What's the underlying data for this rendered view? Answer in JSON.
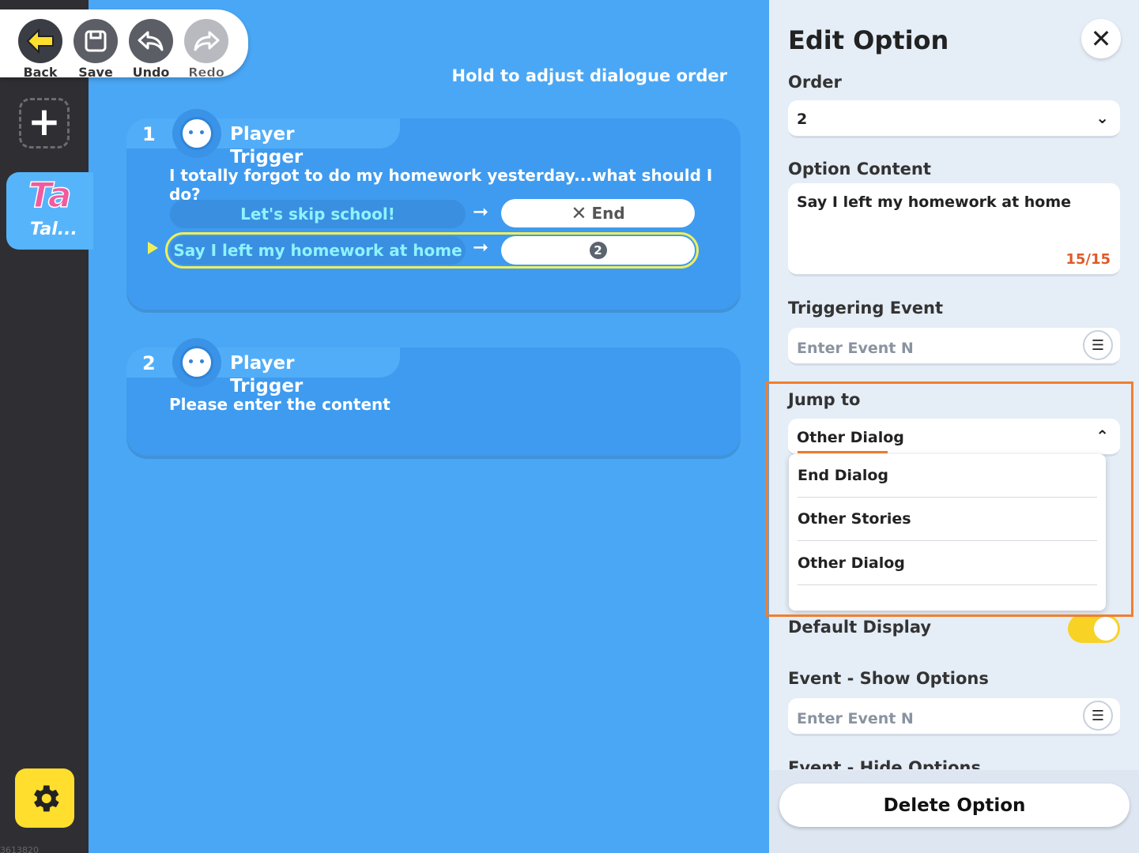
{
  "toolbar": {
    "back_label": "Back",
    "save_label": "Save",
    "undo_label": "Undo",
    "redo_label": "Redo"
  },
  "sidebar": {
    "tab_big": "Ta",
    "tab_small": "Tal...",
    "footer_id": "3613820"
  },
  "hint": "Hold to adjust dialogue order",
  "dialogs": [
    {
      "number": "1",
      "speaker": "Player",
      "trigger": "Trigger",
      "text": "I totally forgot to do my homework yesterday...what should I do?",
      "options": [
        {
          "label": "Let's skip school!",
          "target": "End",
          "target_icon": "x-icon"
        },
        {
          "label": "Say I left my homework at home",
          "target": "2",
          "selected": true
        }
      ]
    },
    {
      "number": "2",
      "speaker": "Player",
      "trigger": "Trigger",
      "text": "Please enter the content"
    }
  ],
  "panel": {
    "title": "Edit Option",
    "order_label": "Order",
    "order_value": "2",
    "content_label": "Option Content",
    "content_value": "Say I left my homework at home",
    "content_counter": "15/15",
    "trigger_label": "Triggering Event",
    "trigger_placeholder": "Enter Event N",
    "jump_label": "Jump to",
    "jump_value": "Other Dialog",
    "jump_options": [
      "End Dialog",
      "Other Stories",
      "Other Dialog"
    ],
    "default_display_label": "Default Display",
    "default_display_on": true,
    "show_options_label": "Event - Show Options",
    "show_options_placeholder": "Enter Event N",
    "hide_options_label": "Event - Hide Options",
    "delete_label": "Delete Option"
  },
  "colors": {
    "canvas": "#4aa7f5",
    "card": "#3e9bef",
    "accent_yellow": "#f0ef5a",
    "highlight_orange": "#f07f2e",
    "counter_red": "#e05a2a"
  }
}
